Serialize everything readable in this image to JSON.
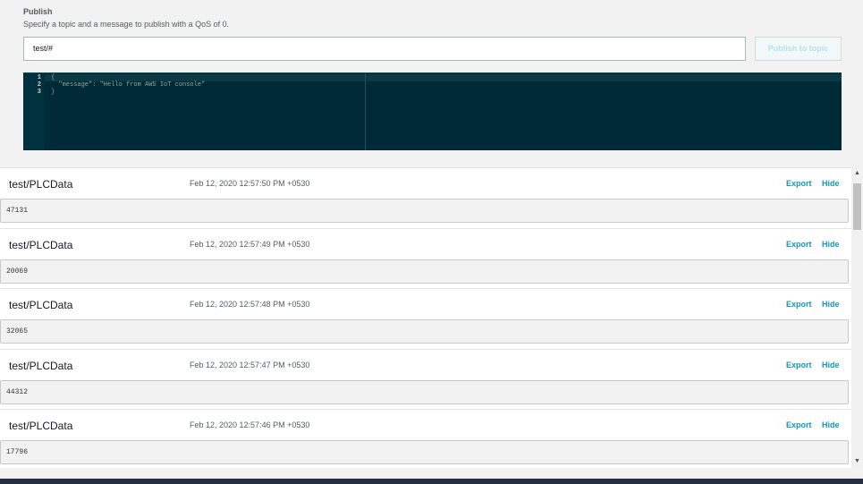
{
  "publish": {
    "title": "Publish",
    "description": "Specify a topic and a message to publish with a QoS of 0.",
    "topic_value": "test/#",
    "button_label": "Publish to topic"
  },
  "editor": {
    "line_numbers": [
      "1",
      "2",
      "3"
    ],
    "lines": [
      "{",
      "  \"message\": \"Hello from AWS IoT console\"",
      "}"
    ]
  },
  "messages": [
    {
      "topic": "test/PLCData",
      "time": "Feb 12, 2020 12:57:50 PM +0530",
      "payload": "47131",
      "export": "Export",
      "hide": "Hide"
    },
    {
      "topic": "test/PLCData",
      "time": "Feb 12, 2020 12:57:49 PM +0530",
      "payload": "20069",
      "export": "Export",
      "hide": "Hide"
    },
    {
      "topic": "test/PLCData",
      "time": "Feb 12, 2020 12:57:48 PM +0530",
      "payload": "32065",
      "export": "Export",
      "hide": "Hide"
    },
    {
      "topic": "test/PLCData",
      "time": "Feb 12, 2020 12:57:47 PM +0530",
      "payload": "44312",
      "export": "Export",
      "hide": "Hide"
    },
    {
      "topic": "test/PLCData",
      "time": "Feb 12, 2020 12:57:46 PM +0530",
      "payload": "17796",
      "export": "Export",
      "hide": "Hide"
    }
  ],
  "colors": {
    "accent": "#0f9bb8",
    "editor_bg": "#002b36"
  }
}
